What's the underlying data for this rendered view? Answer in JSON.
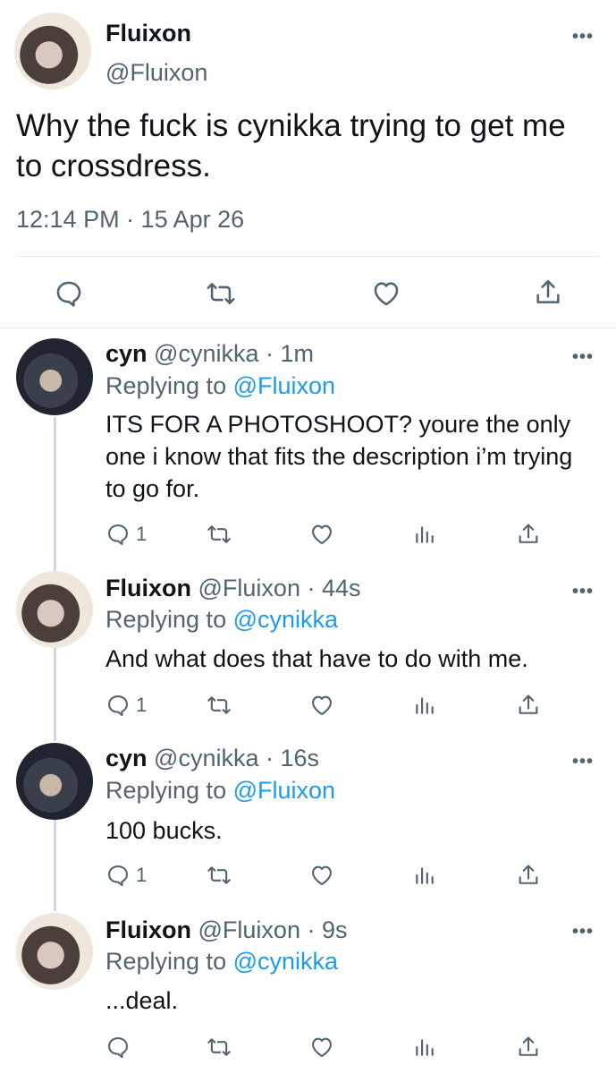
{
  "main_tweet": {
    "name": "Fluixon",
    "handle": "@Fluixon",
    "text": "Why the fuck is cynikka trying to get me to crossdress.",
    "timestamp": "12:14 PM · 15 Apr 26",
    "more": "•••"
  },
  "replies": [
    {
      "name": "cyn",
      "handle_time": "@cynikka · 1m",
      "replying_prefix": "Replying to ",
      "replying_to": "@Fluixon",
      "text": "ITS FOR A PHOTOSHOOT? youre the only one i know that fits the description i’m trying to go for.",
      "reply_count": "1",
      "more": "•••"
    },
    {
      "name": "Fluixon",
      "handle_time": "@Fluixon · 44s",
      "replying_prefix": "Replying to ",
      "replying_to": "@cynikka",
      "text": "And what does that have to do with me.",
      "reply_count": "1",
      "more": "•••"
    },
    {
      "name": "cyn",
      "handle_time": "@cynikka · 16s",
      "replying_prefix": "Replying to ",
      "replying_to": "@Fluixon",
      "text": "100 bucks.",
      "reply_count": "1",
      "more": "•••"
    },
    {
      "name": "Fluixon",
      "handle_time": "@Fluixon · 9s",
      "replying_prefix": "Replying to ",
      "replying_to": "@cynikka",
      "text": "...deal.",
      "reply_count": "",
      "more": "•••"
    }
  ],
  "icons": {
    "reply": "reply-icon",
    "retweet": "retweet-icon",
    "like": "like-icon",
    "share": "share-icon",
    "analytics": "analytics-icon"
  },
  "colors": {
    "link": "#1d9bf0",
    "secondary_text": "#536471",
    "thread_line": "#cfd9de"
  }
}
